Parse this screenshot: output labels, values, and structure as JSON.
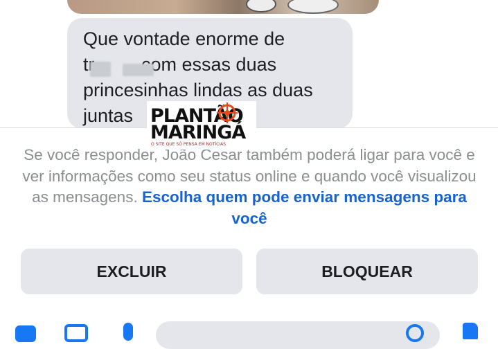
{
  "message": {
    "lines": [
      "Que vontade enorme de",
      "tr         com essas duas",
      "princesinhas lindas as duas",
      "juntas"
    ]
  },
  "watermark": {
    "line1": "PLANTÃO",
    "line2": "MARINGÁ",
    "tagline": "O SITE QUE SÓ PENSA EM NOTÍCIAS"
  },
  "notice": {
    "text": "Se você responder, João Cesar também poderá ligar para você e ver informações como seu status online e quando você visualizou as mensagens.",
    "link": "Escolha quem pode enviar mensagens para você"
  },
  "actions": {
    "delete_label": "EXCLUIR",
    "block_label": "BLOQUEAR"
  },
  "colors": {
    "link": "#1763cf",
    "bubble": "#e4e6eb",
    "accent": "#1877f2",
    "muted_text": "#8a8d91"
  },
  "icons": [
    "camera-icon",
    "gallery-icon",
    "microphone-icon",
    "emoji-icon",
    "like-icon"
  ]
}
